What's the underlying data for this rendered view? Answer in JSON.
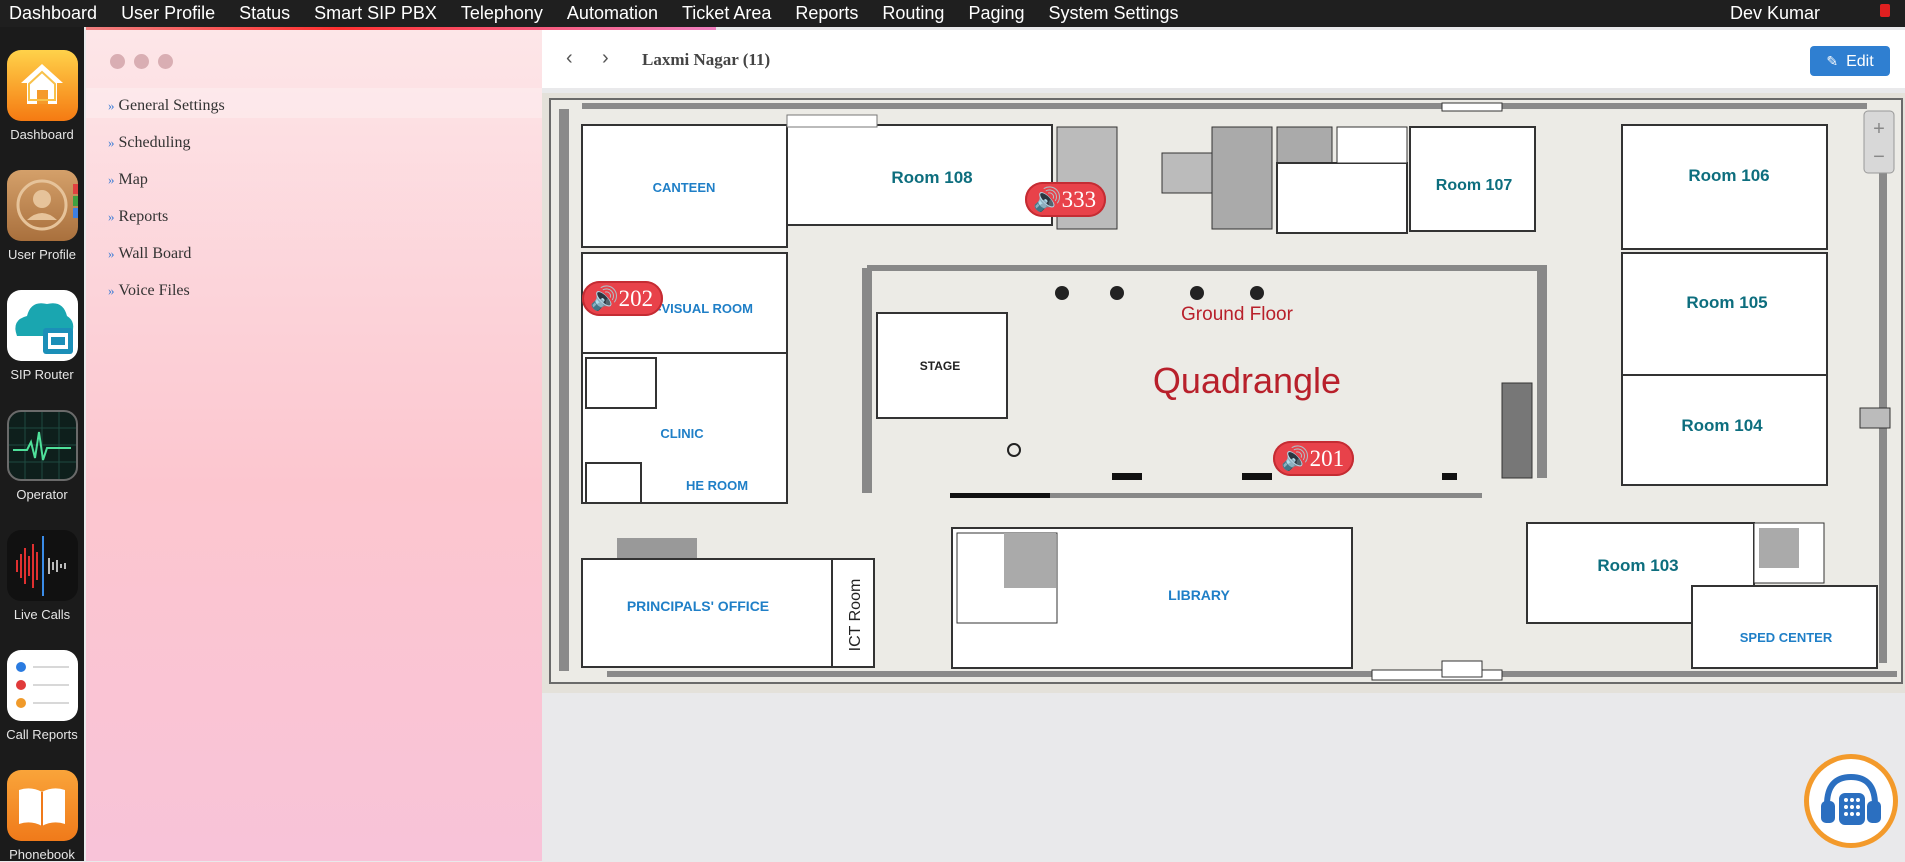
{
  "topbar": {
    "menu": [
      "Dashboard",
      "User Profile",
      "Status",
      "Smart SIP PBX",
      "Telephony",
      "Automation",
      "Ticket Area",
      "Reports",
      "Routing",
      "Paging",
      "System Settings"
    ],
    "user": "Dev Kumar"
  },
  "dock": [
    {
      "label": "Dashboard",
      "icon": "home-icon"
    },
    {
      "label": "User Profile",
      "icon": "user-profile-icon"
    },
    {
      "label": "SIP Router",
      "icon": "sip-router-icon",
      "badge": "SIP"
    },
    {
      "label": "Operator",
      "icon": "operator-icon"
    },
    {
      "label": "Live Calls",
      "icon": "live-calls-icon"
    },
    {
      "label": "Call Reports",
      "icon": "call-reports-icon"
    },
    {
      "label": "Phonebook",
      "icon": "phonebook-icon"
    }
  ],
  "sidebar": {
    "items": [
      "General Settings",
      "Scheduling",
      "Map",
      "Reports",
      "Wall Board",
      "Voice Files"
    ]
  },
  "header": {
    "title": "Laxmi Nagar (11)",
    "edit_label": "Edit"
  },
  "map": {
    "rooms": {
      "canteen": "CANTEEN",
      "room108": "Room 108",
      "room107": "Room 107",
      "room106": "Room 106",
      "room105": "Room 105",
      "room104": "Room 104",
      "room103": "Room 103",
      "av_room": "O-VISUAL ROOM",
      "clinic": "CLINIC",
      "he_room": "HE ROOM",
      "stage": "STAGE",
      "ground_floor": "Ground Floor",
      "quadrangle": "Quadrangle",
      "principals": "PRINCIPALS' OFFICE",
      "ict": "ICT Room",
      "library": "LIBRARY",
      "sped": "SPED CENTER"
    },
    "speakers": [
      "333",
      "202",
      "201"
    ]
  },
  "colors": {
    "topbar": "#1f1f1f",
    "badge": "#e8424a",
    "edit": "#2f7fd1",
    "room_blue": "#1f7fc7",
    "room_teal": "#0d6e7e",
    "quad_red": "#b8202b"
  }
}
